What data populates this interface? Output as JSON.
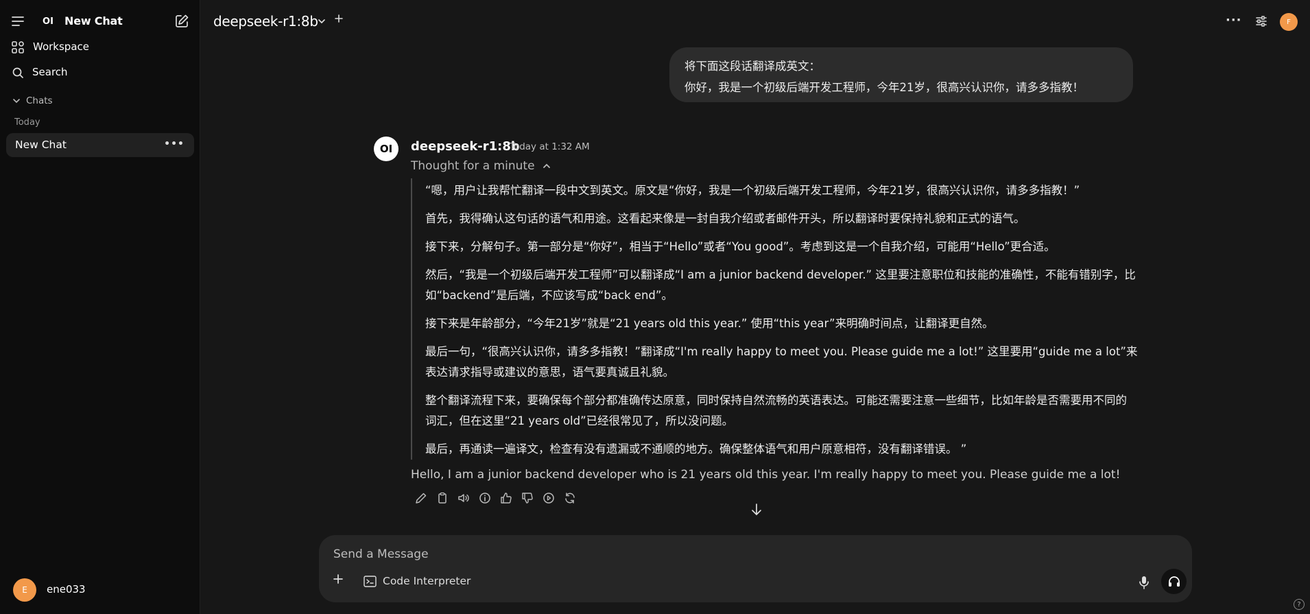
{
  "sidebar": {
    "title": "New Chat",
    "logo": "OI",
    "workspace_label": "Workspace",
    "search_label": "Search",
    "chats_label": "Chats",
    "today_label": "Today",
    "chat_items": [
      {
        "label": "New Chat"
      }
    ],
    "user": {
      "initial": "E",
      "name": "ene033"
    }
  },
  "header": {
    "model": "deepseek-r1:8b",
    "avatar_initial": "F"
  },
  "chat": {
    "user_message_lines": [
      "将下面这段话翻译成英文：",
      "你好，我是一个初级后端开发工程师，今年21岁，很高兴认识你，请多多指教！"
    ],
    "assistant": {
      "logo": "OI",
      "name": "deepseek-r1:8b",
      "time": "Today at 1:32 AM",
      "thought_label": "Thought for a minute",
      "thinking": [
        "“嗯，用户让我帮忙翻译一段中文到英文。原文是“你好，我是一个初级后端开发工程师，今年21岁，很高兴认识你，请多多指教！”",
        "首先，我得确认这句话的语气和用途。这看起来像是一封自我介绍或者邮件开头，所以翻译时要保持礼貌和正式的语气。",
        "接下来，分解句子。第一部分是“你好”，相当于“Hello”或者“You good”。考虑到这是一个自我介绍，可能用“Hello”更合适。",
        "然后，“我是一个初级后端开发工程师”可以翻译成“I am a junior backend developer.” 这里要注意职位和技能的准确性，不能有错别字，比如“backend”是后端，不应该写成“back end”。",
        "接下来是年龄部分，“今年21岁”就是“21 years old this year.” 使用“this year”来明确时间点，让翻译更自然。",
        "最后一句，“很高兴认识你，请多多指教！”翻译成“I'm really happy to meet you. Please guide me a lot!” 这里要用“guide me a lot”来表达请求指导或建议的意思，语气要真诚且礼貌。",
        "整个翻译流程下来，要确保每个部分都准确传达原意，同时保持自然流畅的英语表达。可能还需要注意一些细节，比如年龄是否需要用不同的词汇，但在这里“21 years old”已经很常见了，所以没问题。",
        "最后，再通读一遍译文，检查有没有遗漏或不通顺的地方。确保整体语气和用户原意相符，没有翻译错误。 ”"
      ],
      "answer": "Hello, I am a junior backend developer who is 21 years old this year. I'm really happy to meet you. Please guide me a lot!"
    }
  },
  "composer": {
    "placeholder": "Send a Message",
    "code_interpreter_label": "Code Interpreter"
  },
  "help": "?",
  "colors": {
    "accent_avatar": "#f2994a",
    "background": "#171717",
    "sidebar": "#0d0d0d"
  }
}
